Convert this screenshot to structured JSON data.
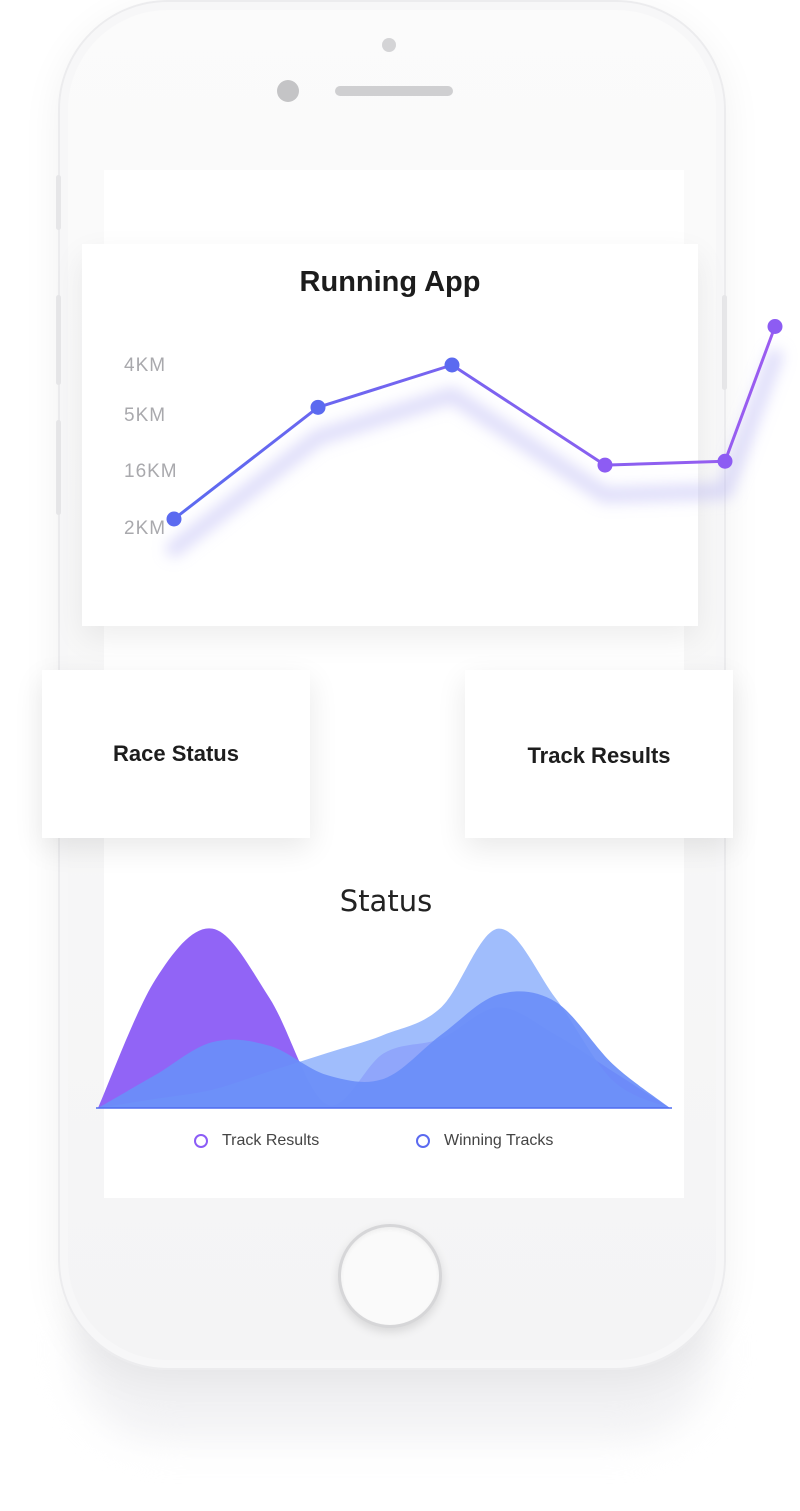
{
  "app": {
    "title": "Running App"
  },
  "chart_data": [
    {
      "type": "line",
      "title": "Running App",
      "y_tick_labels": [
        "4KM",
        "5KM",
        "16KM",
        "2KM"
      ],
      "x": [
        1,
        2,
        3,
        4,
        5,
        6
      ],
      "series": [
        {
          "values": [
            1.0,
            3.9,
            5.0,
            2.4,
            2.5,
            6.0
          ],
          "color": "#5b6af0"
        }
      ],
      "grid": false
    },
    {
      "type": "area",
      "title": "Status",
      "x": [
        0,
        10,
        20,
        30,
        40,
        50,
        60,
        70,
        80,
        90,
        100
      ],
      "series": [
        {
          "name": "Track Results",
          "color": "#8b5cf6",
          "values": [
            0,
            70,
            98,
            60,
            2,
            30,
            38,
            55,
            40,
            20,
            0
          ]
        },
        {
          "name": "Winning Tracks",
          "color": "#6a8ef8",
          "values": [
            0,
            18,
            36,
            34,
            18,
            16,
            40,
            62,
            58,
            24,
            0
          ]
        },
        {
          "name": "",
          "color": "#8fb2fb",
          "values": [
            0,
            5,
            10,
            20,
            30,
            40,
            55,
            98,
            60,
            15,
            0
          ]
        }
      ],
      "legend_position": "bottom"
    }
  ],
  "cards": {
    "race_status": "Race Status",
    "track_results": "Track Results"
  },
  "status": {
    "title": "Status"
  },
  "legend": {
    "track_results": "Track Results",
    "winning_tracks": "Winning Tracks"
  },
  "colors": {
    "purple": "#8b5cf6",
    "blue": "#5b6af0",
    "light_blue": "#8fb2fb"
  }
}
